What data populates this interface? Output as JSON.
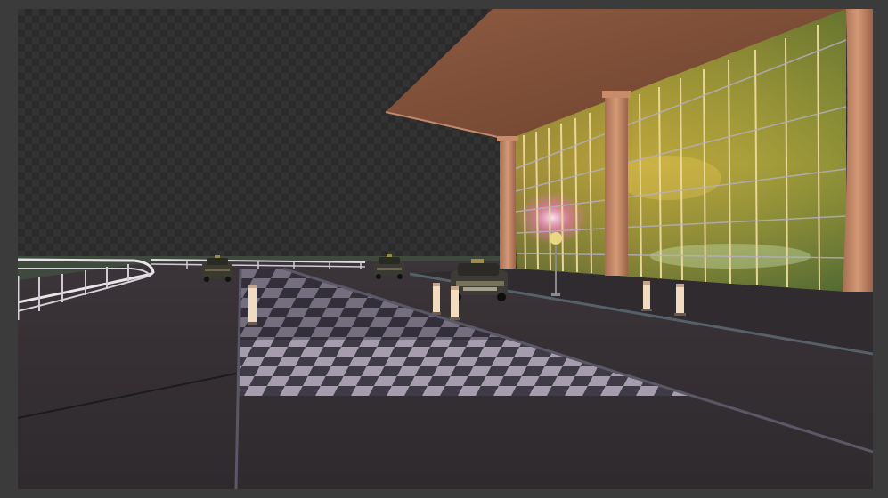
{
  "viewport": {
    "background": "transparent-checkerboard",
    "checker_colors": [
      "#262626",
      "#333333"
    ]
  },
  "scene": {
    "objects": [
      "canopy-roof",
      "glass-facade",
      "support-column",
      "taxi-car",
      "bollard",
      "street-lamp",
      "guard-rail",
      "checkered-walkway",
      "asphalt-road"
    ],
    "colors": {
      "roof": "#7a4a34",
      "roof_edge": "#b07a5c",
      "column": "#c88c6a",
      "glass_warm": "#b8a23a",
      "glass_green": "#7d8a3a",
      "asphalt": "#3a3438",
      "walkway_light": "#a59cae",
      "walkway_dark": "#3f3b46",
      "bollard": "#f2dcc0"
    }
  }
}
